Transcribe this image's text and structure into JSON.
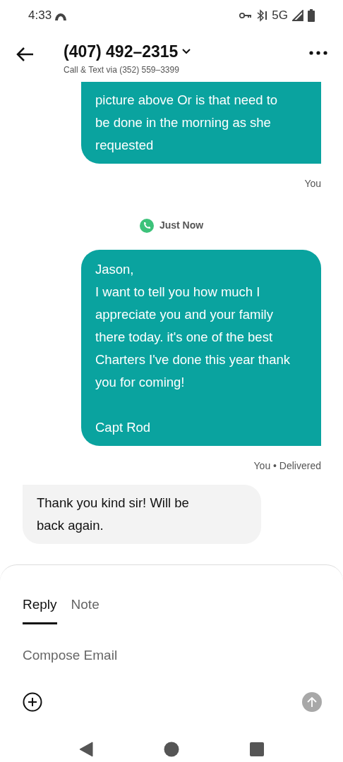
{
  "status_bar": {
    "time": "4:33",
    "network": "5G"
  },
  "header": {
    "title": "(407) 492–2315",
    "subtitle": "Call & Text via (352) 559–3399"
  },
  "messages": [
    {
      "kind": "outgoing",
      "text": "picture above Or is that need to be done in the morning as she requested",
      "top_cut": true,
      "meta": "You"
    },
    {
      "kind": "divider",
      "text": "Just Now"
    },
    {
      "kind": "outgoing",
      "text": "Jason,\nI want to tell you how much I appreciate you and your family there today. it's one of the best Charters I've done this year thank you for coming!\n\nCapt Rod",
      "top_cut": false,
      "meta": "You • Delivered"
    },
    {
      "kind": "incoming",
      "text": "Thank you kind sir! Will be back again."
    }
  ],
  "composer": {
    "tabs": [
      {
        "label": "Reply",
        "selected": true
      },
      {
        "label": "Note",
        "selected": false
      }
    ],
    "placeholder": "Compose Email"
  }
}
